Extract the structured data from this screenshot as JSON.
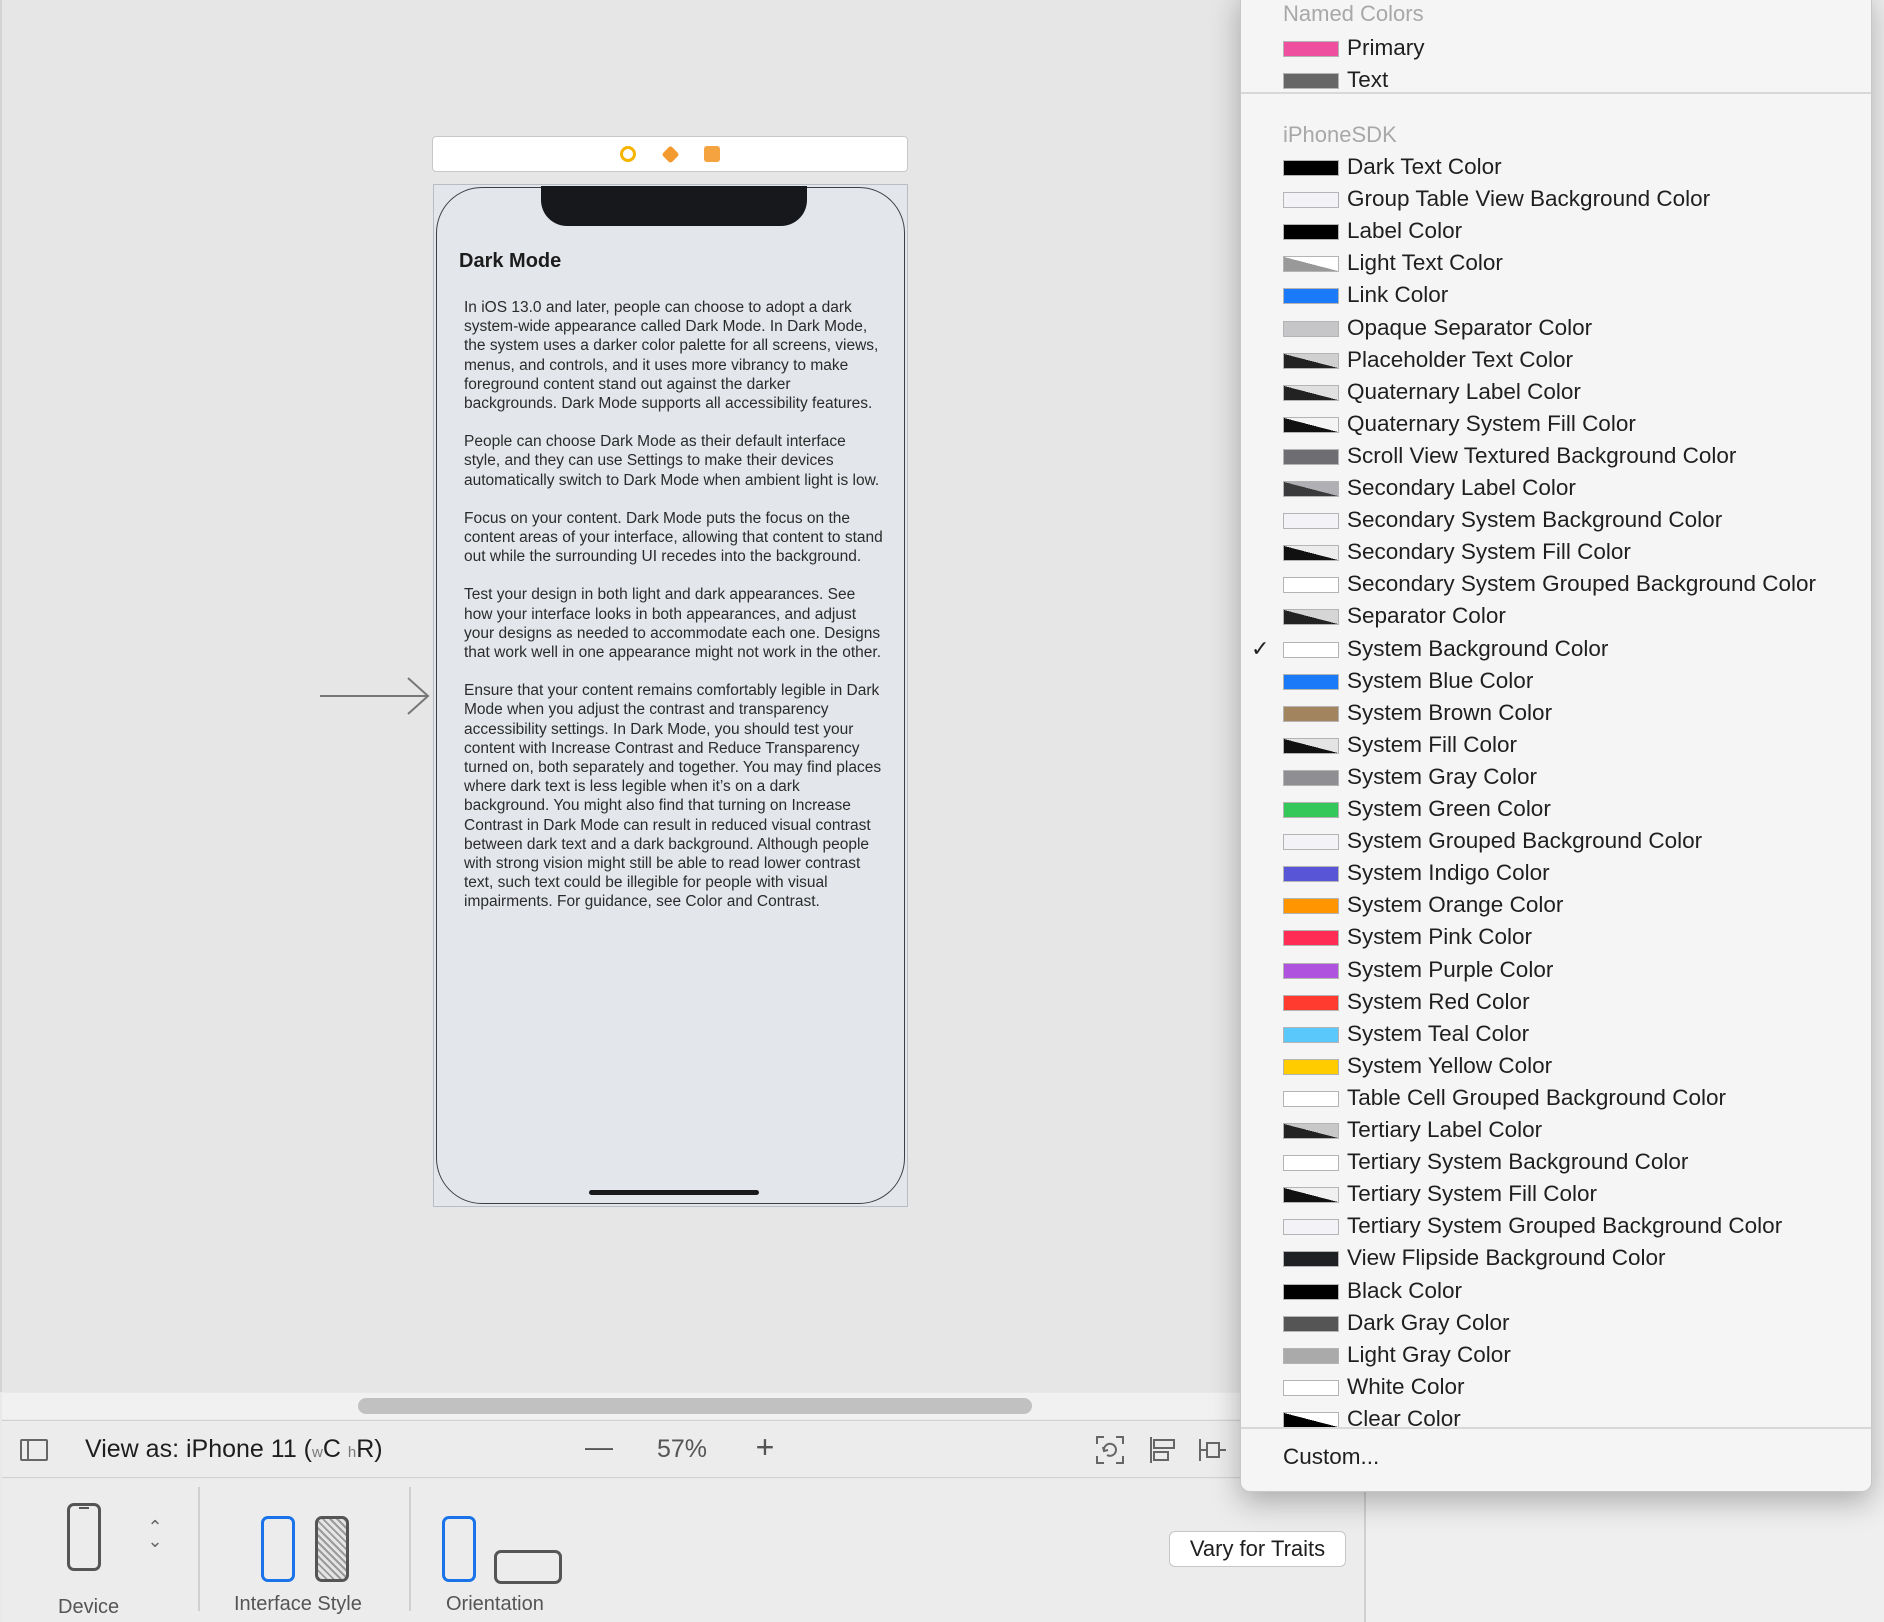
{
  "canvas": {
    "scene_title": "Dark Mode",
    "paragraphs": [
      "In iOS 13.0 and later, people can choose to adopt a dark system-wide appearance called Dark Mode. In Dark Mode, the system uses a darker color palette for all screens, views, menus, and controls, and it uses more vibrancy to make foreground content stand out against the darker backgrounds. Dark Mode supports all accessibility features.",
      "People can choose Dark Mode as their default interface style, and they can use Settings to make their devices automatically switch to Dark Mode when ambient light is low.",
      "Focus on your content. Dark Mode puts the focus on the content areas of your interface, allowing that content to stand out while the surrounding UI recedes into the background.",
      "Test your design in both light and dark appearances. See how your interface looks in both appearances, and adjust your designs as needed to accommodate each one. Designs that work well in one appearance might not work in the other.",
      "Ensure that your content remains comfortably legible in Dark Mode when you adjust the contrast and transparency accessibility settings. In Dark Mode, you should test your content with Increase Contrast and Reduce Transparency turned on, both separately and together. You may find places where dark text is less legible when it’s on a dark background. You might also find that turning on Increase Contrast in Dark Mode can result in reduced visual contrast between dark text and a dark background. Although people with strong vision might still be able to read lower contrast text, such text could be illegible for people with visual impairments. For guidance, see Color and Contrast."
    ]
  },
  "bottom_bar": {
    "view_as_prefix": "View as: iPhone 11 (",
    "size_w": "w",
    "size_w_value": "C",
    "size_h": "h",
    "size_h_value": "R",
    "view_as_suffix": ")",
    "zoom_out": "—",
    "zoom_level": "57%",
    "zoom_in": "+"
  },
  "traits": {
    "device_label": "Device",
    "interface_style_label": "Interface Style",
    "orientation_label": "Orientation",
    "vary_for_traits": "Vary for Traits"
  },
  "color_menu": {
    "named_header": "Named Colors",
    "named_colors": [
      {
        "label": "Primary",
        "color": "#ef4f9f"
      },
      {
        "label": "Text",
        "color": "#666666"
      }
    ],
    "sdk_header": "iPhoneSDK",
    "selected": "System Background Color",
    "sdk_colors": [
      {
        "label": "Dark Text Color",
        "color": "#000000"
      },
      {
        "label": "Group Table View Background Color",
        "color": "#f2f2f7"
      },
      {
        "label": "Label Color",
        "color": "#000000"
      },
      {
        "label": "Light Text Color",
        "color": "#999999",
        "diag": "#ffffff"
      },
      {
        "label": "Link Color",
        "color": "#1a7af8"
      },
      {
        "label": "Opaque Separator Color",
        "color": "#c6c6c8"
      },
      {
        "label": "Placeholder Text Color",
        "color": "#222222",
        "diag": "#d0d0d0"
      },
      {
        "label": "Quaternary Label Color",
        "color": "#222222",
        "diag": "#e0e0e0"
      },
      {
        "label": "Quaternary System Fill Color",
        "color": "#111111",
        "diag": "#f4f4f4"
      },
      {
        "label": "Scroll View Textured Background Color",
        "color": "#6d6d72"
      },
      {
        "label": "Secondary Label Color",
        "color": "#3a3a3c",
        "diag": "#b0b0b4"
      },
      {
        "label": "Secondary System Background Color",
        "color": "#f2f2f7"
      },
      {
        "label": "Secondary System Fill Color",
        "color": "#111111",
        "diag": "#ececec"
      },
      {
        "label": "Secondary System Grouped Background Color",
        "color": "#ffffff"
      },
      {
        "label": "Separator Color",
        "color": "#222222",
        "diag": "#d6d6d6"
      },
      {
        "label": "System Background Color",
        "color": "#ffffff"
      },
      {
        "label": "System Blue Color",
        "color": "#1a7af8"
      },
      {
        "label": "System Brown Color",
        "color": "#a2845e"
      },
      {
        "label": "System Fill Color",
        "color": "#111111",
        "diag": "#e4e4e4"
      },
      {
        "label": "System Gray Color",
        "color": "#8e8e93"
      },
      {
        "label": "System Green Color",
        "color": "#34c759"
      },
      {
        "label": "System Grouped Background Color",
        "color": "#f2f2f7"
      },
      {
        "label": "System Indigo Color",
        "color": "#5856d6"
      },
      {
        "label": "System Orange Color",
        "color": "#ff9500"
      },
      {
        "label": "System Pink Color",
        "color": "#ff2d55"
      },
      {
        "label": "System Purple Color",
        "color": "#af52de"
      },
      {
        "label": "System Red Color",
        "color": "#ff3b30"
      },
      {
        "label": "System Teal Color",
        "color": "#5ac8fa"
      },
      {
        "label": "System Yellow Color",
        "color": "#ffcc00"
      },
      {
        "label": "Table Cell Grouped Background Color",
        "color": "#ffffff"
      },
      {
        "label": "Tertiary Label Color",
        "color": "#222222",
        "diag": "#c8c8c8"
      },
      {
        "label": "Tertiary System Background Color",
        "color": "#ffffff"
      },
      {
        "label": "Tertiary System Fill Color",
        "color": "#111111",
        "diag": "#f0f0f0"
      },
      {
        "label": "Tertiary System Grouped Background Color",
        "color": "#f2f2f7"
      },
      {
        "label": "View Flipside Background Color",
        "color": "#1f2024"
      },
      {
        "label": "Black Color",
        "color": "#000000"
      },
      {
        "label": "Dark Gray Color",
        "color": "#555555"
      },
      {
        "label": "Light Gray Color",
        "color": "#aaaaaa"
      },
      {
        "label": "White Color",
        "color": "#ffffff"
      },
      {
        "label": "Clear Color",
        "color": "#000000",
        "diag": "#ffffff"
      }
    ],
    "custom_label": "Custom..."
  }
}
